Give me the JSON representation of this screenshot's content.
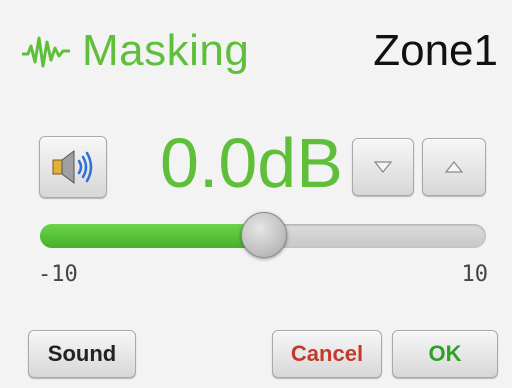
{
  "header": {
    "icon": "masking-wave-icon",
    "title": "Masking",
    "zone": "Zone1"
  },
  "level": {
    "value_text": "0.0dB",
    "value": 0.0,
    "min": -10,
    "max": 10
  },
  "slider": {
    "min_label": "-10",
    "max_label": "10"
  },
  "controls": {
    "speaker_icon": "speaker-icon",
    "down_icon": "triangle-down-icon",
    "up_icon": "triangle-up-icon"
  },
  "buttons": {
    "sound": "Sound",
    "cancel": "Cancel",
    "ok": "OK"
  },
  "colors": {
    "accent_green": "#5fbf3a",
    "cancel_red": "#c43a2a",
    "ok_green": "#2f9f2a"
  }
}
